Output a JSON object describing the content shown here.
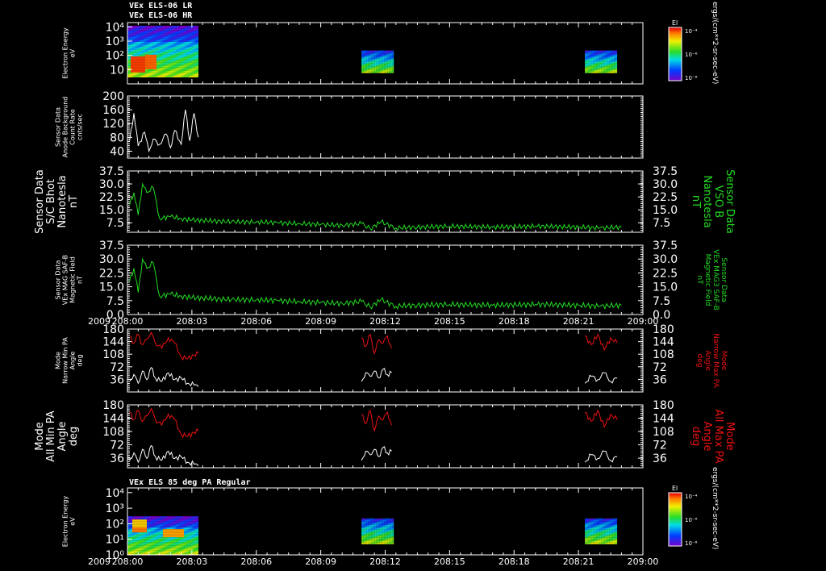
{
  "header": {
    "line1": "VEx ELS-06 LR",
    "line2": "VEx ELS-06 HR"
  },
  "colors": {
    "background": "#000000",
    "axis": "#ffffff",
    "mag": "#22dd22",
    "max_pa": "#ee1111",
    "min_pa": "#ffffff"
  },
  "chart_data": [
    {
      "type": "heatmap",
      "id": "els_energy_top",
      "ylabel": [
        "Electron Energy",
        "eV"
      ],
      "ylog": true,
      "ylim": [
        1,
        20000
      ],
      "yticks": [
        {
          "v": 10,
          "label": "10"
        },
        {
          "v": 100,
          "label": "10²"
        },
        {
          "v": 1000,
          "label": "10³"
        },
        {
          "v": 10000,
          "label": "10⁴"
        }
      ],
      "segments_min": [
        [
          0,
          3.3
        ],
        [
          10.9,
          12.4
        ],
        [
          21.3,
          22.8
        ]
      ],
      "colorbar": {
        "title": "El",
        "ticks": [
          "10⁻⁴",
          "10⁻⁶",
          "10⁻⁸"
        ],
        "unit": "ergs/(cm**2-sr-sec-eV)"
      }
    },
    {
      "type": "line",
      "id": "anode_bg",
      "ylabel": [
        "Sensor Data",
        "Anode Background",
        "Count Rate",
        "cnts/sec"
      ],
      "ylim": [
        20,
        200
      ],
      "yticks": [
        40,
        80,
        120,
        160,
        200
      ],
      "series": [
        {
          "color": "#ffffff",
          "x": [
            0.1,
            0.3,
            0.5,
            0.8,
            1.0,
            1.2,
            1.5,
            1.8,
            2.0,
            2.2,
            2.5,
            2.7,
            2.9,
            3.1,
            3.3
          ],
          "y": [
            70,
            150,
            55,
            95,
            40,
            75,
            60,
            90,
            50,
            100,
            60,
            160,
            70,
            150,
            80
          ]
        }
      ]
    },
    {
      "type": "line",
      "id": "bmag_sc",
      "ylabel": [
        "Sensor Data",
        "S/C Bhot",
        "Nanotesla",
        "nT"
      ],
      "rlabel": [
        "Sensor Data",
        "VSO B",
        "Nanotesla",
        "nT"
      ],
      "ylim": [
        2,
        37.5
      ],
      "yticks": [
        "7.5",
        "15.0",
        "22.5",
        "30.0",
        "37.5"
      ],
      "series": [
        {
          "color": "#22dd22",
          "x": [
            0.1,
            0.3,
            0.5,
            0.7,
            0.9,
            1.2,
            1.5,
            2,
            2.5,
            3,
            3.5,
            4,
            5,
            6,
            7,
            8,
            9,
            10,
            10.9,
            11.3,
            11.8,
            12.5,
            13.5,
            15,
            17,
            19,
            21,
            22,
            23
          ],
          "y": [
            18,
            25,
            12,
            30,
            25,
            28,
            10,
            11,
            10,
            9,
            9,
            8.5,
            8,
            8,
            7.5,
            7,
            6.5,
            6,
            7,
            4,
            8,
            4.5,
            5,
            5.5,
            5,
            5.5,
            5,
            4.5,
            5
          ]
        }
      ]
    },
    {
      "type": "line",
      "id": "bmag_saf",
      "ylabel": [
        "Sensor Data",
        "VEx MAG SAF-B",
        "Magnetic Field",
        "nT"
      ],
      "rlabel": [
        "Sensor Data",
        "VEx MAG3 SAF-B",
        "Magnetic Field",
        "nT"
      ],
      "ylim": [
        0,
        37.5
      ],
      "yticks": [
        "0.0",
        "7.5",
        "15.0",
        "22.5",
        "30.0",
        "37.5"
      ],
      "series": [
        {
          "color": "#22dd22",
          "x": [
            0.1,
            0.3,
            0.5,
            0.7,
            0.9,
            1.2,
            1.5,
            2,
            2.5,
            3,
            3.5,
            4,
            5,
            6,
            7,
            8,
            9,
            10,
            10.9,
            11.3,
            11.8,
            12.5,
            13.5,
            15,
            17,
            19,
            21,
            22,
            23
          ],
          "y": [
            18,
            25,
            12,
            30,
            25,
            28,
            10,
            11,
            10,
            9,
            9,
            8.5,
            8,
            8,
            7.5,
            7,
            6.5,
            6,
            7,
            4,
            8,
            4.5,
            5,
            5.5,
            5,
            5.5,
            5,
            4.5,
            5
          ]
        }
      ]
    },
    {
      "type": "line",
      "id": "pa_narrow",
      "ylabel": [
        "Mode",
        "Narrow Min PA",
        "Angle",
        "deg"
      ],
      "rlabel": [
        "Mode",
        "Narrow Max PA",
        "Angle",
        "deg"
      ],
      "ylim": [
        0,
        180
      ],
      "yticks": [
        36,
        72,
        108,
        144,
        180
      ],
      "series": [
        {
          "color": "#ee1111",
          "segments": [
            {
              "x": [
                0.1,
                0.3,
                0.5,
                0.7,
                0.9,
                1.1,
                1.3,
                1.6,
                1.9,
                2.2,
                2.5,
                2.8,
                3.1,
                3.3
              ],
              "y": [
                160,
                140,
                165,
                135,
                150,
                170,
                140,
                125,
                155,
                140,
                100,
                95,
                105,
                110
              ]
            },
            {
              "x": [
                10.9,
                11.1,
                11.3,
                11.5,
                11.7,
                11.9,
                12.1,
                12.3
              ],
              "y": [
                155,
                130,
                165,
                110,
                150,
                140,
                160,
                125
              ]
            },
            {
              "x": [
                21.3,
                21.6,
                21.9,
                22.2,
                22.5,
                22.8
              ],
              "y": [
                160,
                135,
                165,
                120,
                155,
                140
              ]
            }
          ]
        },
        {
          "color": "#ffffff",
          "segments": [
            {
              "x": [
                0.1,
                0.3,
                0.5,
                0.7,
                0.9,
                1.1,
                1.3,
                1.6,
                1.9,
                2.2,
                2.5,
                2.8,
                3.1,
                3.3
              ],
              "y": [
                30,
                50,
                25,
                60,
                35,
                70,
                40,
                30,
                55,
                35,
                40,
                25,
                20,
                15
              ]
            },
            {
              "x": [
                10.9,
                11.1,
                11.3,
                11.5,
                11.7,
                11.9,
                12.1,
                12.3
              ],
              "y": [
                30,
                55,
                45,
                60,
                40,
                65,
                50,
                55
              ]
            },
            {
              "x": [
                21.3,
                21.6,
                21.9,
                22.2,
                22.5,
                22.8
              ],
              "y": [
                25,
                45,
                35,
                55,
                30,
                40
              ]
            }
          ]
        }
      ]
    },
    {
      "type": "line",
      "id": "pa_all",
      "ylabel": [
        "Mode",
        "All Min PA",
        "Angle",
        "deg"
      ],
      "rlabel": [
        "Mode",
        "All Max PA",
        "Angle",
        "deg"
      ],
      "ylim": [
        10,
        180
      ],
      "yticks": [
        36,
        72,
        108,
        144,
        180
      ],
      "series": [
        {
          "color": "#ee1111",
          "segments": [
            {
              "x": [
                0.1,
                0.3,
                0.5,
                0.7,
                0.9,
                1.1,
                1.3,
                1.6,
                1.9,
                2.2,
                2.5,
                2.8,
                3.1,
                3.3
              ],
              "y": [
                160,
                140,
                165,
                135,
                150,
                170,
                140,
                125,
                155,
                140,
                100,
                95,
                105,
                110
              ]
            },
            {
              "x": [
                10.9,
                11.1,
                11.3,
                11.5,
                11.7,
                11.9,
                12.1,
                12.3
              ],
              "y": [
                155,
                130,
                165,
                110,
                150,
                140,
                160,
                125
              ]
            },
            {
              "x": [
                21.3,
                21.6,
                21.9,
                22.2,
                22.5,
                22.8
              ],
              "y": [
                160,
                135,
                165,
                120,
                155,
                140
              ]
            }
          ]
        },
        {
          "color": "#ffffff",
          "segments": [
            {
              "x": [
                0.1,
                0.3,
                0.5,
                0.7,
                0.9,
                1.1,
                1.3,
                1.6,
                1.9,
                2.2,
                2.5,
                2.8,
                3.1,
                3.3
              ],
              "y": [
                30,
                50,
                25,
                60,
                35,
                70,
                40,
                30,
                55,
                35,
                40,
                25,
                20,
                15
              ]
            },
            {
              "x": [
                10.9,
                11.1,
                11.3,
                11.5,
                11.7,
                11.9,
                12.1,
                12.3
              ],
              "y": [
                30,
                55,
                45,
                60,
                40,
                65,
                50,
                55
              ]
            },
            {
              "x": [
                21.3,
                21.6,
                21.9,
                22.2,
                22.5,
                22.8
              ],
              "y": [
                25,
                45,
                35,
                55,
                30,
                40
              ]
            }
          ]
        }
      ]
    },
    {
      "type": "heatmap",
      "id": "els_energy_bottom",
      "title": "VEx ELS 85 deg PA Regular",
      "ylabel": [
        "Electron Energy",
        "eV"
      ],
      "ylog": true,
      "ylim": [
        1,
        20000
      ],
      "yticks": [
        {
          "v": 1,
          "label": "10⁰"
        },
        {
          "v": 10,
          "label": "10¹"
        },
        {
          "v": 100,
          "label": "10²"
        },
        {
          "v": 1000,
          "label": "10³"
        },
        {
          "v": 10000,
          "label": "10⁴"
        }
      ],
      "segments_min": [
        [
          0,
          3.3
        ],
        [
          10.9,
          12.4
        ],
        [
          21.3,
          22.8
        ]
      ],
      "colorbar": {
        "title": "El",
        "ticks": [
          "10⁻⁴",
          "10⁻⁶",
          "10⁻⁸"
        ],
        "unit": "ergs/(cm**2-sr-sec-eV)"
      }
    }
  ],
  "time_axis": {
    "year": "2009",
    "xlim_min": [
      0,
      24
    ],
    "ticks": [
      {
        "t": 0,
        "label": "208:00"
      },
      {
        "t": 3,
        "label": "208:03"
      },
      {
        "t": 6,
        "label": "208:06"
      },
      {
        "t": 9,
        "label": "208:09"
      },
      {
        "t": 12,
        "label": "208:12"
      },
      {
        "t": 15,
        "label": "208:15"
      },
      {
        "t": 18,
        "label": "208:18"
      },
      {
        "t": 21,
        "label": "208:21"
      },
      {
        "t": 24,
        "label": "209:00"
      }
    ]
  }
}
